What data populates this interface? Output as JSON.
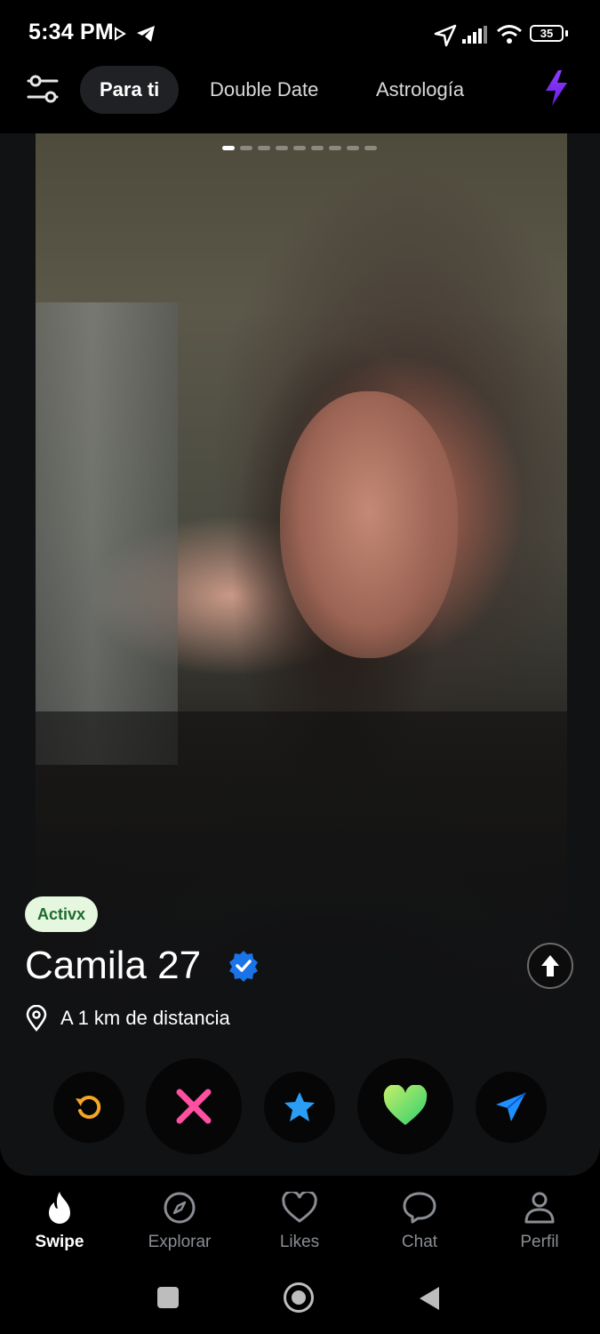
{
  "status_bar": {
    "time": "5:34 PM",
    "battery": "35"
  },
  "top_nav": {
    "tabs": [
      {
        "label": "Para ti",
        "active": true
      },
      {
        "label": "Double Date",
        "active": false
      },
      {
        "label": "Astrología",
        "active": false
      }
    ]
  },
  "profile": {
    "photo_count": 9,
    "current_photo": 1,
    "status_badge": "Activx",
    "name_age": "Camila 27",
    "distance": "A 1 km de distancia"
  },
  "actions": [
    "rewind-icon",
    "nope-icon",
    "super-like-icon",
    "like-icon",
    "boost-icon"
  ],
  "bottom_nav": {
    "items": [
      {
        "label": "Swipe",
        "icon": "flame-icon",
        "active": true
      },
      {
        "label": "Explorar",
        "icon": "compass-icon",
        "active": false
      },
      {
        "label": "Likes",
        "icon": "heart-icon",
        "active": false
      },
      {
        "label": "Chat",
        "icon": "chat-bubble-icon",
        "active": false
      },
      {
        "label": "Perfil",
        "icon": "person-icon",
        "active": false
      }
    ]
  },
  "colors": {
    "accent": "#7b2cf5",
    "like": "#7ee35a",
    "nope": "#ff4fa0",
    "star": "#2a9df4",
    "rewind": "#f5a623",
    "badge_bg": "#e5f7de"
  }
}
